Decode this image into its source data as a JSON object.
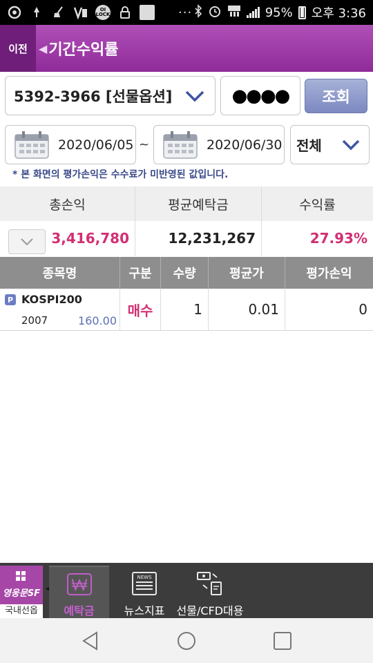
{
  "status_bar": {
    "battery": "95%",
    "time": "오후 3:36",
    "lock_badge": "OI LOCK",
    "more": "···"
  },
  "header": {
    "back_label": "이전",
    "title": "기간수익률"
  },
  "account": {
    "selected": "5392-3966 [선물옵션]",
    "password_masked": "●●●●",
    "search_label": "조회"
  },
  "period": {
    "start_date": "2020/06/05",
    "separator": "~",
    "end_date": "2020/06/30",
    "filter": "전체"
  },
  "notice": "* 본 화면의 평가손익은 수수료가 미반영된 값입니다.",
  "summary": {
    "headers": [
      "총손익",
      "평균예탁금",
      "수익률"
    ],
    "total_pnl": "3,416,780",
    "avg_deposit": "12,231,267",
    "return_rate": "27.93%"
  },
  "holdings": {
    "headers": [
      "종목명",
      "구분",
      "수량",
      "평균가",
      "평가손익"
    ],
    "rows": [
      {
        "badge": "P",
        "name": "KOSPI200",
        "expiry": "2007",
        "strike": "160.00",
        "side": "매수",
        "qty": "1",
        "avg_price": "0.01",
        "eval_pnl": "0"
      }
    ]
  },
  "bottom_nav": {
    "home_brand": "영웅문SF",
    "home_label": "국내선옵",
    "items": [
      {
        "label": "예탁금",
        "icon": "won-icon"
      },
      {
        "label": "뉴스지표",
        "icon": "news-icon"
      },
      {
        "label": "선물/CFD대용",
        "icon": "exchange-icon"
      }
    ],
    "news_icon_text": "NEWS"
  },
  "colors": {
    "header": "#9b39a5",
    "accent_pink": "#d12f73",
    "search_button": "#8a95c9"
  }
}
